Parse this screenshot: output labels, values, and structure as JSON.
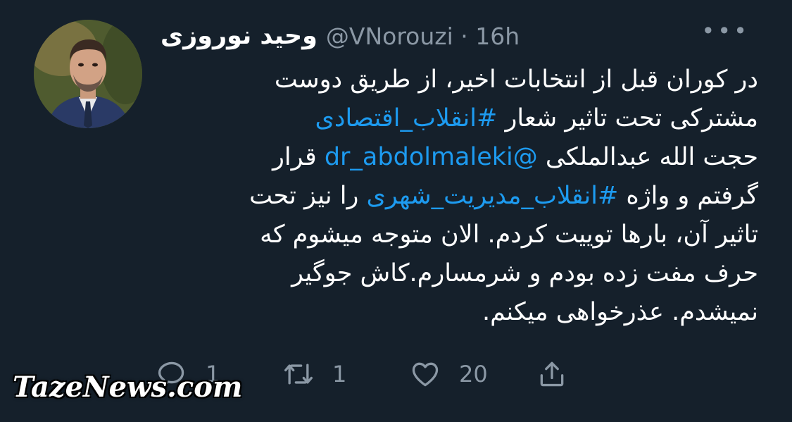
{
  "author": {
    "display_name": "وحید نوروزی",
    "handle": "@VNorouzi",
    "separator": " · ",
    "time": "16h"
  },
  "more_icon": "more-horizontal-icon",
  "tweet": {
    "lines": [
      {
        "parts": [
          {
            "text": "در کوران قبل از انتخابات اخیر، از طریق دوست",
            "link": false
          }
        ]
      },
      {
        "parts": [
          {
            "text": "مشترکی تحت تاثیر شعار ",
            "link": false
          },
          {
            "text": "#انقلاب_اقتصادی",
            "link": true
          }
        ]
      },
      {
        "parts": [
          {
            "text": "حجت الله عبدالملکی ",
            "link": false
          },
          {
            "text": "@dr_abdolmaleki",
            "link": true
          },
          {
            "text": " قرار",
            "link": false
          }
        ]
      },
      {
        "parts": [
          {
            "text": "گرفتم و واژه ",
            "link": false
          },
          {
            "text": "#انقلاب_مدیریت_شهری",
            "link": true
          },
          {
            "text": " را نیز تحت",
            "link": false
          }
        ]
      },
      {
        "parts": [
          {
            "text": "تاثیر آن، بارها توییت کردم. الان متوجه میشوم که",
            "link": false
          }
        ]
      },
      {
        "parts": [
          {
            "text": "حرف مفت زده بودم و شرمسارم.کاش جوگیر",
            "link": false
          }
        ]
      },
      {
        "parts": [
          {
            "text": "نمیشدم. عذرخواهی میکنم.",
            "link": false
          }
        ]
      }
    ]
  },
  "actions": {
    "reply": {
      "icon": "reply-icon",
      "count": "1"
    },
    "retweet": {
      "icon": "retweet-icon",
      "count": "1"
    },
    "like": {
      "icon": "heart-icon",
      "count": "20"
    },
    "share": {
      "icon": "share-icon",
      "count": ""
    }
  },
  "watermark": "TazeNews.com",
  "colors": {
    "background": "#15202b",
    "text": "#ffffff",
    "secondary": "#8b98a5",
    "link": "#1d9bf0"
  }
}
